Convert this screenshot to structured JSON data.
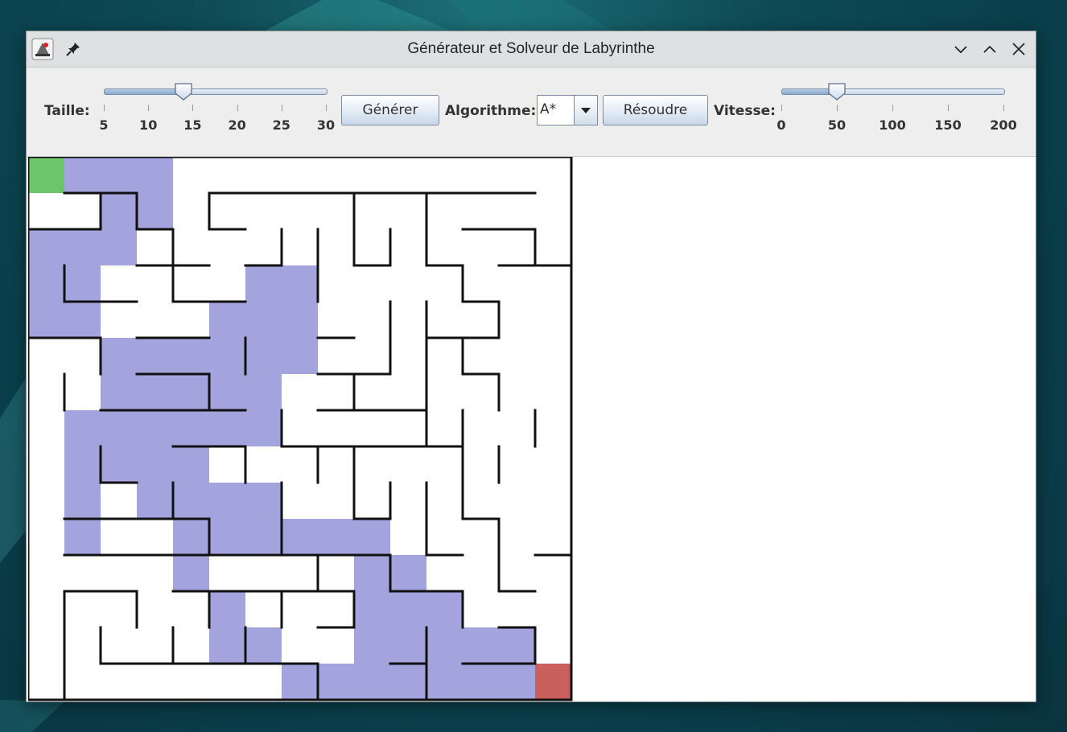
{
  "window": {
    "title": "Générateur et Solveur de Labyrinthe"
  },
  "toolbar": {
    "size_label": "Taille:",
    "size_slider": {
      "min": 5,
      "max": 30,
      "value": 14,
      "ticks": [
        "5",
        "10",
        "15",
        "20",
        "25",
        "30"
      ]
    },
    "generate_button": "Générer",
    "algorithm_label": "Algorithme:",
    "algorithm_value": "A*",
    "solve_button": "Résoudre",
    "speed_label": "Vitesse:",
    "speed_slider": {
      "min": 0,
      "max": 200,
      "value": 50,
      "ticks": [
        "0",
        "50",
        "100",
        "150",
        "200"
      ]
    }
  },
  "maze": {
    "rows": 15,
    "cols": 15,
    "colors": {
      "start": "#6cc56a",
      "end": "#c9605e",
      "path": "#a3a3de",
      "wall": "#111111"
    },
    "start": [
      0,
      0
    ],
    "end": [
      14,
      14
    ]
  }
}
